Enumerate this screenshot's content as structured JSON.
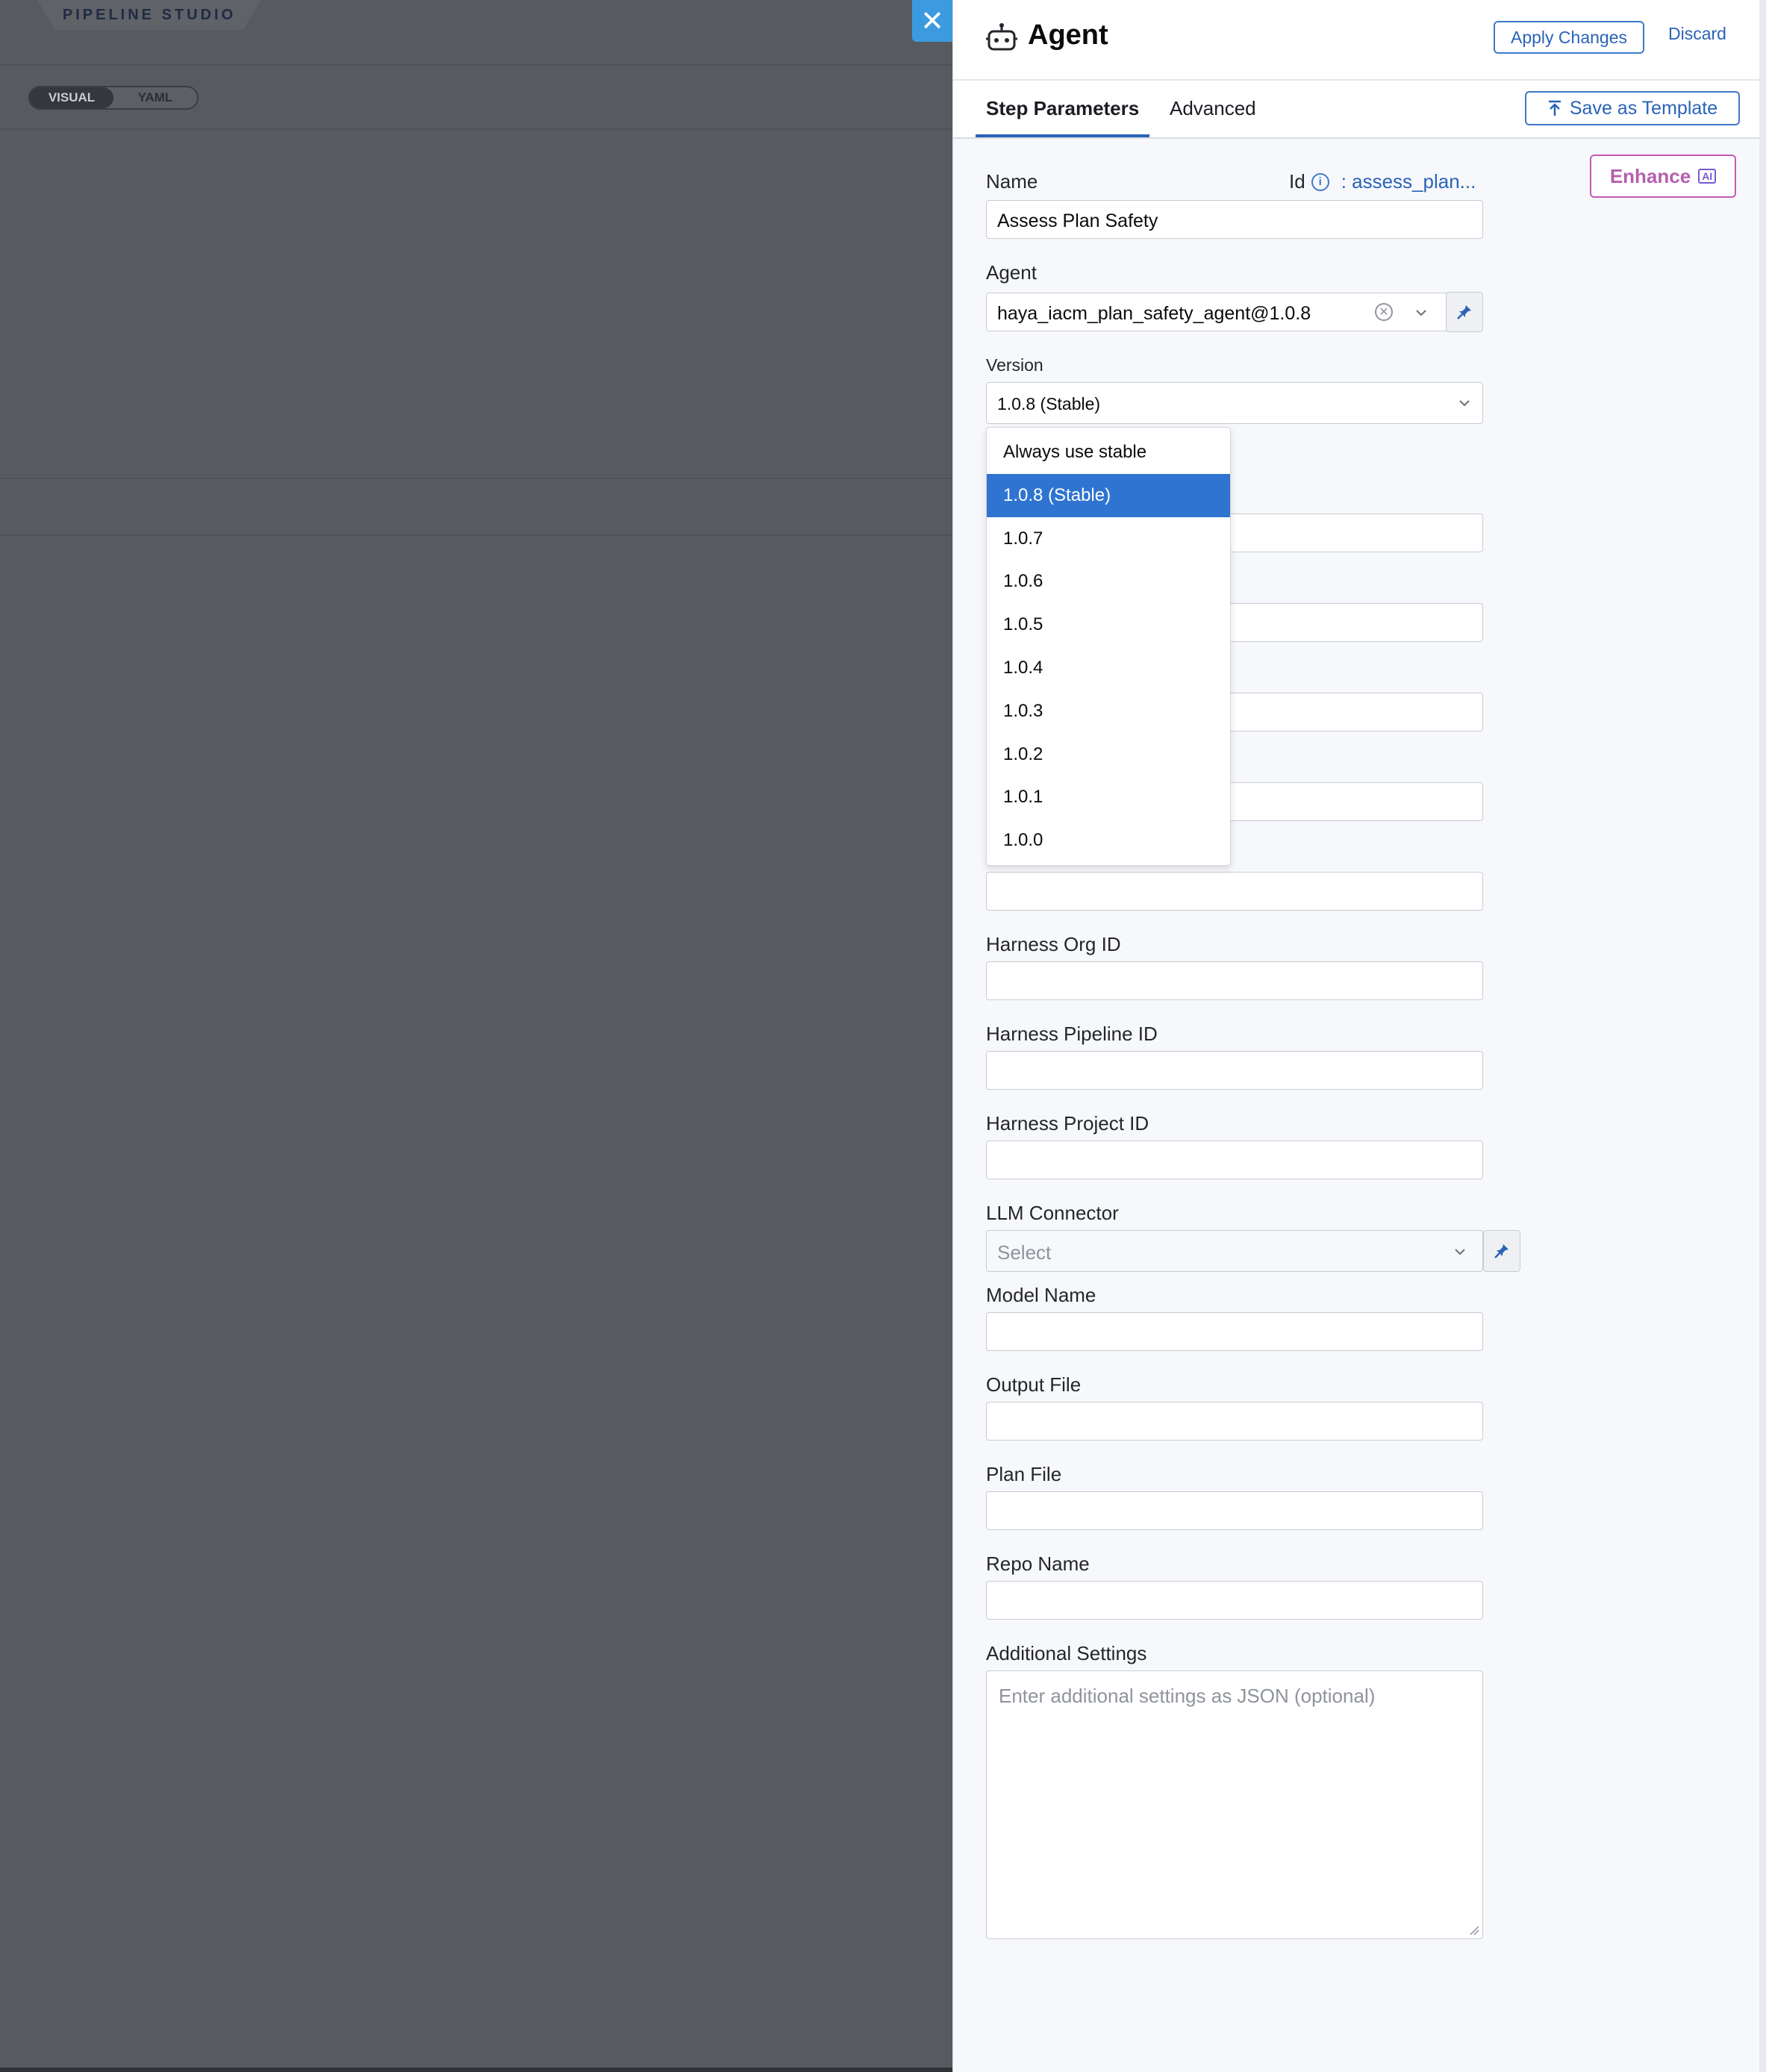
{
  "background": {
    "studio_label": "PIPELINE STUDIO",
    "toggle": [
      "VISUAL",
      "YAML"
    ]
  },
  "close_glyph": "✕",
  "header": {
    "title": "Agent",
    "apply_label": "Apply Changes",
    "discard_label": "Discard"
  },
  "tabs": {
    "step_params": "Step Parameters",
    "advanced": "Advanced",
    "save_template": "Save as Template"
  },
  "enhance": {
    "label": "Enhance",
    "badge": "AI"
  },
  "name": {
    "label": "Name",
    "value": "Assess Plan Safety",
    "id_label": "Id",
    "id_value": ": assess_plan..."
  },
  "agent": {
    "label": "Agent",
    "value": "haya_iacm_plan_safety_agent@1.0.8"
  },
  "version": {
    "label": "Version",
    "value": "1.0.8 (Stable)",
    "options": [
      "Always use stable",
      "1.0.8 (Stable)",
      "1.0.7",
      "1.0.6",
      "1.0.5",
      "1.0.4",
      "1.0.3",
      "1.0.2",
      "1.0.1",
      "1.0.0"
    ],
    "selected_index": 1
  },
  "fields": {
    "org_id": "Harness Org ID",
    "pipeline_id": "Harness Pipeline ID",
    "project_id": "Harness Project ID",
    "llm_connector": "LLM Connector",
    "llm_placeholder": "Select",
    "model_name": "Model Name",
    "output_file": "Output File",
    "plan_file": "Plan File",
    "repo_name": "Repo Name",
    "additional_settings": "Additional Settings",
    "additional_placeholder": "Enter additional settings as JSON (optional)"
  },
  "colors": {
    "accent": "#2a63b8",
    "selected": "#2f74d0",
    "overlay": "#575a5f",
    "enhance": "#b45fb0"
  }
}
